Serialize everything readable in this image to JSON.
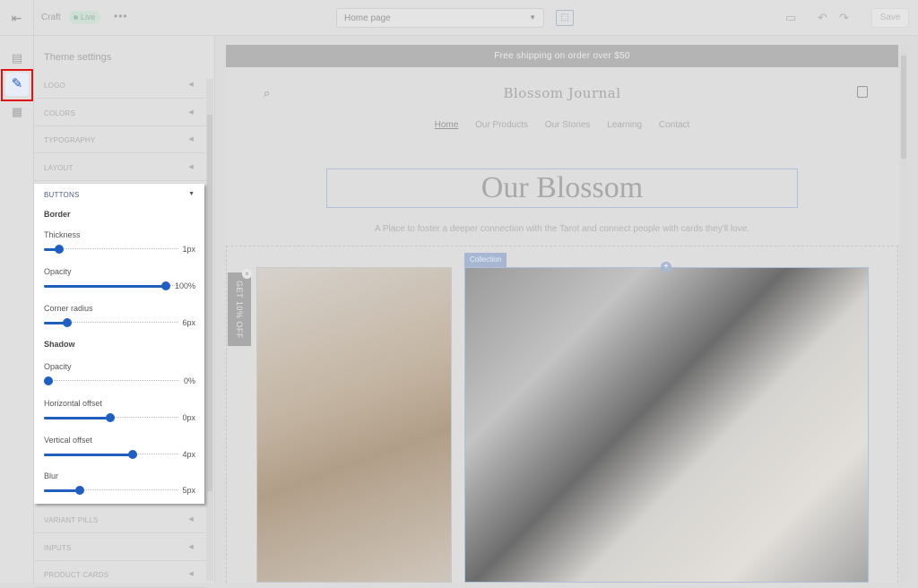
{
  "topbar": {
    "store_name": "Craft",
    "status_badge": "Live",
    "more_label": "•••",
    "page_select": "Home page",
    "save_label": "Save"
  },
  "rail": {
    "items": [
      "sections-icon",
      "theme-settings-icon",
      "apps-icon"
    ],
    "active": "theme-settings-icon"
  },
  "panel": {
    "title": "Theme settings",
    "sections_above": [
      "LOGO",
      "COLORS",
      "TYPOGRAPHY",
      "LAYOUT"
    ],
    "sections_below": [
      "VARIANT PILLS",
      "INPUTS",
      "PRODUCT CARDS"
    ],
    "buttons": {
      "title": "BUTTONS",
      "border_heading": "Border",
      "shadow_heading": "Shadow",
      "sliders": [
        {
          "label": "Thickness",
          "value": "1px",
          "level": 0.09
        },
        {
          "label": "Opacity",
          "value": "100%",
          "level": 1.0
        },
        {
          "label": "Corner radius",
          "value": "6px",
          "level": 0.16
        },
        {
          "label": "Opacity",
          "value": "0%",
          "level": 0.0
        },
        {
          "label": "Horizontal offset",
          "value": "0px",
          "level": 0.53
        },
        {
          "label": "Vertical offset",
          "value": "4px",
          "level": 0.72
        },
        {
          "label": "Blur",
          "value": "5px",
          "level": 0.27
        }
      ]
    }
  },
  "preview": {
    "announcement": "Free shipping on order over $50",
    "brand": "Blossom Journal",
    "nav": [
      "Home",
      "Our Products",
      "Our Stories",
      "Learning",
      "Contact"
    ],
    "hero_title": "Our Blossom",
    "hero_subtitle": "A Place to foster a deeper connection with the Tarot and connect people with cards they'll love.",
    "collection_tag": "Collection",
    "side_tab": "GET 10% OFF"
  },
  "colors": {
    "accent": "#1f5fbf",
    "highlight": "#e01414"
  }
}
